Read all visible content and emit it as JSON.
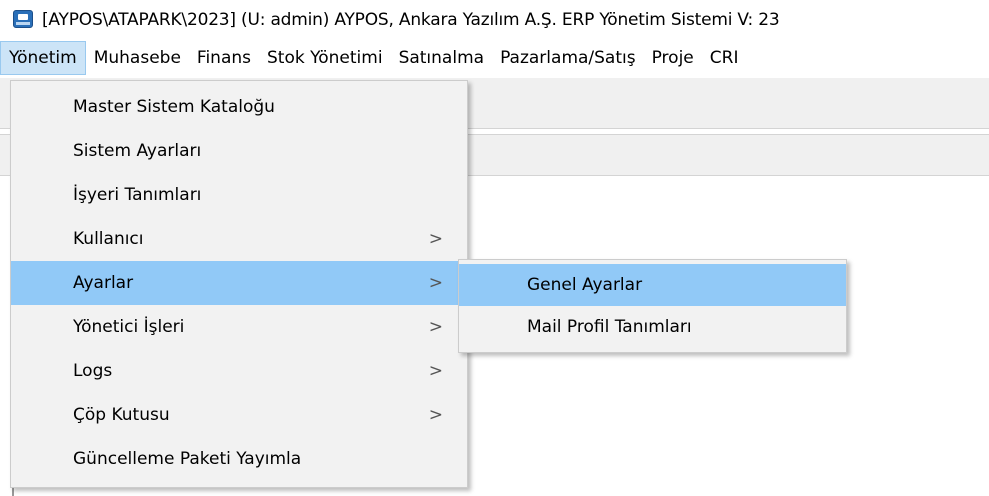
{
  "window": {
    "title": "[AYPOS\\ATAPARK\\2023] (U: admin) AYPOS, Ankara Yazılım A.Ş. ERP Yönetim Sistemi V: 23"
  },
  "menubar": {
    "items": [
      {
        "label": "Yönetim",
        "active": true
      },
      {
        "label": "Muhasebe"
      },
      {
        "label": "Finans"
      },
      {
        "label": "Stok Yönetimi"
      },
      {
        "label": "Satınalma"
      },
      {
        "label": "Pazarlama/Satış"
      },
      {
        "label": "Proje"
      },
      {
        "label": "CRI"
      }
    ]
  },
  "dropdown": {
    "items": [
      {
        "label": "Master Sistem Kataloğu"
      },
      {
        "label": "Sistem Ayarları"
      },
      {
        "label": "İşyeri Tanımları"
      },
      {
        "label": "Kullanıcı",
        "submenu": true
      },
      {
        "label": "Ayarlar",
        "submenu": true,
        "highlighted": true
      },
      {
        "label": "Yönetici İşleri",
        "submenu": true
      },
      {
        "label": "Logs",
        "submenu": true
      },
      {
        "label": "Çöp Kutusu",
        "submenu": true
      },
      {
        "label": "Güncelleme Paketi Yayımla"
      }
    ],
    "chevron": ">"
  },
  "submenu": {
    "items": [
      {
        "label": "Genel Ayarlar",
        "highlighted": true
      },
      {
        "label": "Mail Profil Tanımları"
      }
    ]
  },
  "colors": {
    "highlight": "#91c9f7",
    "menu_active": "#cce4f7",
    "menu_background": "#f2f2f2"
  },
  "icons": {
    "app": "app-icon",
    "chevron": "chevron-right-icon"
  }
}
